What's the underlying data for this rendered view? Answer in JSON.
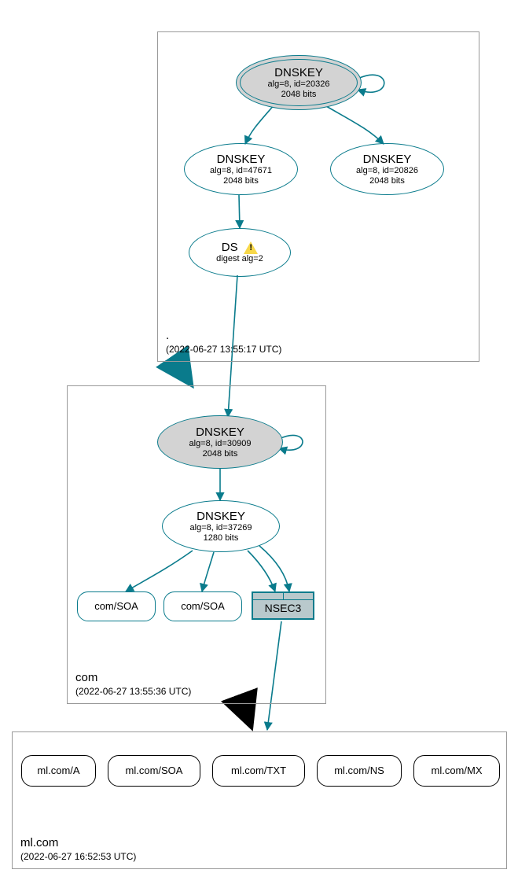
{
  "colors": {
    "teal": "#0a7b8c",
    "grayFill": "#d3d3d3",
    "nsec3Fill": "#b9c9cc"
  },
  "zones": {
    "root": {
      "name": ".",
      "timestamp": "(2022-06-27 13:55:17 UTC)"
    },
    "com": {
      "name": "com",
      "timestamp": "(2022-06-27 13:55:36 UTC)"
    },
    "mlcom": {
      "name": "ml.com",
      "timestamp": "(2022-06-27 16:52:53 UTC)"
    }
  },
  "nodes": {
    "root_ksk": {
      "title": "DNSKEY",
      "line2": "alg=8, id=20326",
      "line3": "2048 bits"
    },
    "root_zsk1": {
      "title": "DNSKEY",
      "line2": "alg=8, id=47671",
      "line3": "2048 bits"
    },
    "root_zsk2": {
      "title": "DNSKEY",
      "line2": "alg=8, id=20826",
      "line3": "2048 bits"
    },
    "root_ds": {
      "title": "DS",
      "line2": "digest alg=2"
    },
    "com_ksk": {
      "title": "DNSKEY",
      "line2": "alg=8, id=30909",
      "line3": "2048 bits"
    },
    "com_zsk": {
      "title": "DNSKEY",
      "line2": "alg=8, id=37269",
      "line3": "1280 bits"
    },
    "com_soa1": {
      "label": "com/SOA"
    },
    "com_soa2": {
      "label": "com/SOA"
    },
    "nsec3": {
      "label": "NSEC3"
    },
    "ml_a": {
      "label": "ml.com/A"
    },
    "ml_soa": {
      "label": "ml.com/SOA"
    },
    "ml_txt": {
      "label": "ml.com/TXT"
    },
    "ml_ns": {
      "label": "ml.com/NS"
    },
    "ml_mx": {
      "label": "ml.com/MX"
    }
  }
}
